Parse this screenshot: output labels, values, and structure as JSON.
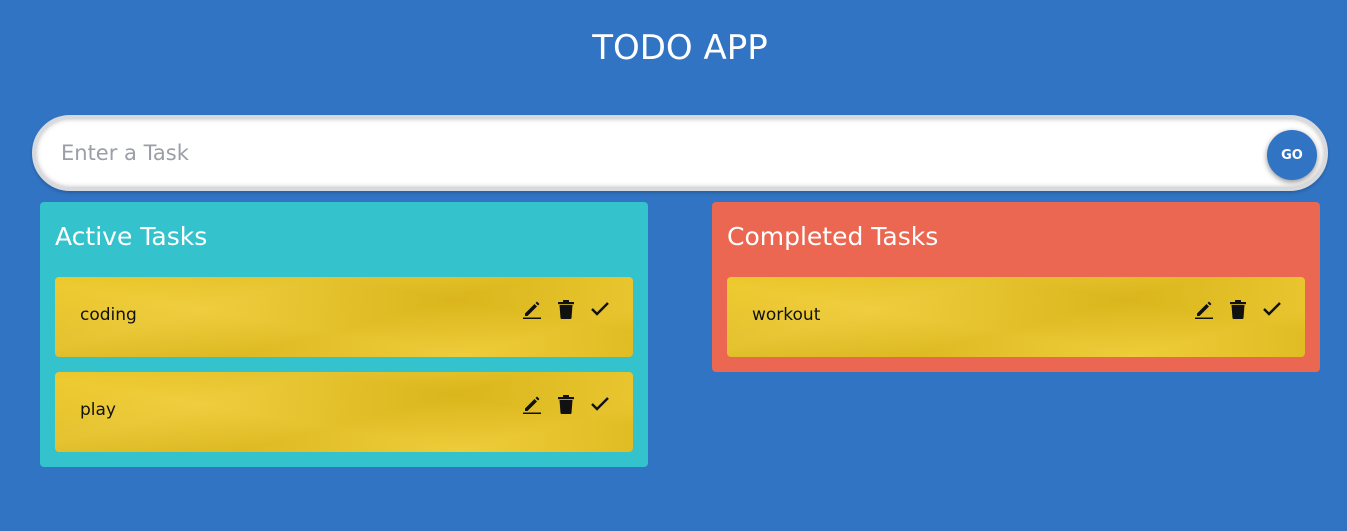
{
  "app": {
    "title": "TODO APP"
  },
  "input": {
    "placeholder": "Enter a Task",
    "value": "",
    "go_label": "GO"
  },
  "active": {
    "title": "Active Tasks",
    "tasks": [
      {
        "text": "coding"
      },
      {
        "text": "play"
      }
    ]
  },
  "completed": {
    "title": "Completed Tasks",
    "tasks": [
      {
        "text": "workout"
      }
    ]
  },
  "colors": {
    "background": "#3174c4",
    "active_panel": "#34c3cd",
    "completed_panel": "#ec6752",
    "task_card": "#ecc51e",
    "go_button": "#3174c4"
  },
  "icons": {
    "edit": "pencil-icon",
    "delete": "trash-icon",
    "complete": "check-icon"
  }
}
